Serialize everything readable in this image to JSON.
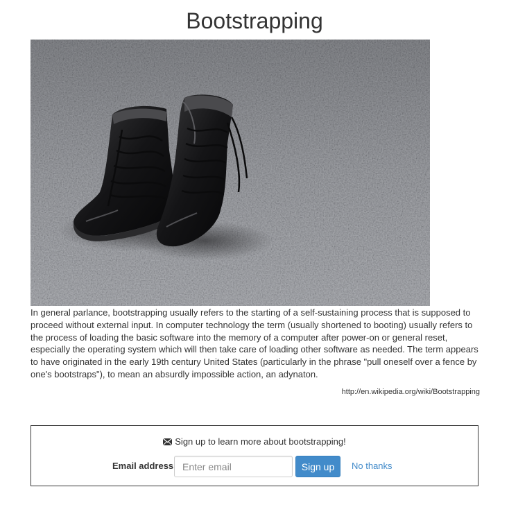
{
  "page": {
    "title": "Bootstrapping"
  },
  "photo": {
    "subject": "pair of black leather boots on asphalt",
    "icon": "boots-photo"
  },
  "description": "In general parlance, bootstrapping usually refers to the starting of a self-sustaining process that is supposed to proceed without external input. In computer technology the term (usually shortened to booting) usually refers to the process of loading the basic software into the memory of a computer after power-on or general reset, especially the operating system which will then take care of loading other software as needed. The term appears to have originated in the early 19th century United States (particularly in the phrase \"pull oneself over a fence by one's bootstraps\"), to mean an absurdly impossible action, an adynaton.",
  "source_link": "http://en.wikipedia.org/wiki/Bootstrapping",
  "signup": {
    "message": "Sign up to learn more about bootstrapping!",
    "icon": "envelope-icon",
    "email_label": "Email address",
    "email_placeholder": "Enter email",
    "email_value": "",
    "submit_label": "Sign up",
    "dismiss_label": "No thanks"
  },
  "colors": {
    "primary": "#428bca",
    "text": "#333333",
    "link": "#428bca"
  }
}
